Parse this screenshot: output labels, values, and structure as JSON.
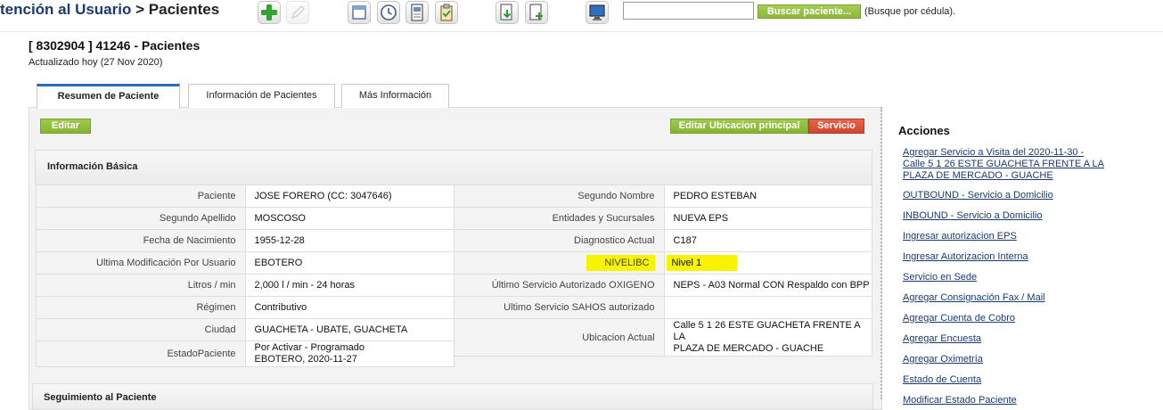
{
  "header": {
    "title_part1": "tención al Usuario",
    "title_separator": ">",
    "title_current": "Pacientes",
    "page_title": "[ 8302904 ] 41246 - Pacientes",
    "updated": "Actualizado hoy (27 Nov 2020)"
  },
  "toolbar": {
    "icons": [
      "add-icon",
      "edit-icon",
      "window-icon",
      "clock-icon",
      "document-icon",
      "clipboard-icon",
      "download-icon",
      "new-document-icon",
      "monitor-icon"
    ],
    "search": {
      "value": "",
      "placeholder": "",
      "button_label": "Buscar paciente...",
      "hint": "(Busque por cédula)."
    }
  },
  "tabs": [
    {
      "label": "Resumen de Paciente",
      "active": true
    },
    {
      "label": "Información de Pacientes",
      "active": false
    },
    {
      "label": "Más Información",
      "active": false
    }
  ],
  "actions": {
    "edit_label": "Editar",
    "edit_location_label": "Editar Ubicacion principal",
    "service_label": "Servicio"
  },
  "basic_info": {
    "title": "Información Básica",
    "rows": [
      {
        "l1": "Paciente",
        "v1": "JOSE FORERO (CC: 3047646)",
        "l2": "Segundo Nombre",
        "v2": "PEDRO ESTEBAN"
      },
      {
        "l1": "Segundo Apellido",
        "v1": "MOSCOSO",
        "l2": "Entidades y Sucursales",
        "v2": "NUEVA EPS"
      },
      {
        "l1": "Fecha de Nacimiento",
        "v1": "1955-12-28",
        "l2": "Diagnostico Actual",
        "v2": "C187"
      },
      {
        "l1": "Ultima Modificación Por Usuario",
        "v1": "EBOTERO",
        "l2": "NIVELIBC",
        "v2": "Nivel 1"
      },
      {
        "l1": "Litros / min",
        "v1": "2,000 l / min - 24 horas",
        "l2": "Último Servicio Autorizado OXIGENO",
        "v2": "NEPS - A03 Normal CON Respaldo con BPP"
      },
      {
        "l1": "Régimen",
        "v1": "Contributivo",
        "l2": "Ultimo Servicio SAHOS autorizado",
        "v2": ""
      },
      {
        "l1": "Ciudad",
        "v1": "GUACHETA - UBATE, GUACHETA",
        "l2": "Ubicacion Actual",
        "v2_line1": "Calle 5 1 26 ESTE GUACHETA FRENTE A LA",
        "v2_line2": "PLAZA DE MERCADO - GUACHE"
      },
      {
        "l1": "EstadoPaciente",
        "v1_line1": "Por Activar - Programado",
        "v1_line2": "EBOTERO, 2020-11-27"
      }
    ],
    "highlight_color": "#f8f400"
  },
  "followup": {
    "title": "Seguimiento al Paciente"
  },
  "sidebar": {
    "title": "Acciones",
    "links": [
      {
        "line1": "Agregar Servicio a Visita del 2020-11-30 -",
        "line2": "Calle 5 1 26 ESTE GUACHETA FRENTE A LA",
        "line3": "PLAZA DE MERCADO - GUACHE"
      },
      {
        "line1": "OUTBOUND - Servicio a Domicilio"
      },
      {
        "line1": "INBOUND - Servicio a Domicilio"
      },
      {
        "line1": "Ingresar autorizacion EPS"
      },
      {
        "line1": "Ingresar Autorizacion Interna"
      },
      {
        "line1": "Servicio en Sede"
      },
      {
        "line1": "Agregar Consignación Fax / Mail"
      },
      {
        "line1": "Agregar Cuenta de Cobro"
      },
      {
        "line1": "Agregar Encuesta"
      },
      {
        "line1": "Agregar Oximetría"
      },
      {
        "line1": "Estado de Cuenta"
      },
      {
        "line1": "Modificar Estado Paciente"
      }
    ]
  },
  "colors": {
    "title_blue": "#1a3a73",
    "tab_active": "#2a6fb4",
    "button_green": "#8cb83b",
    "button_red": "#cf4630"
  }
}
